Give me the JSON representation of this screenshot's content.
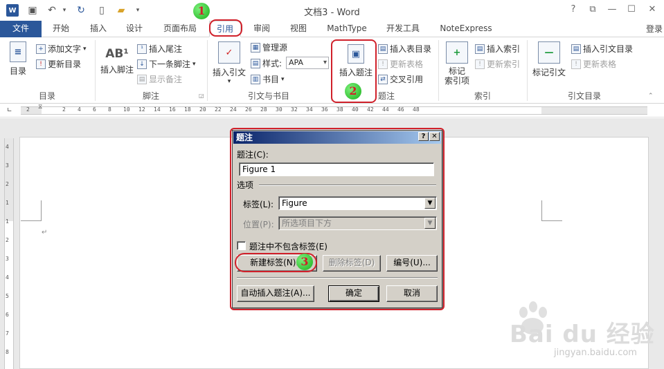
{
  "window": {
    "title": "文档3 - Word",
    "controls": [
      "?",
      "⧉",
      "—",
      "☐",
      "✕"
    ]
  },
  "quick_access": {
    "icons": [
      "word-logo",
      "save-icon",
      "undo-icon",
      "redo-icon",
      "new-doc-icon",
      "open-folder-icon",
      "customize-icon"
    ]
  },
  "tabs": [
    {
      "label": "文件"
    },
    {
      "label": "开始"
    },
    {
      "label": "插入"
    },
    {
      "label": "设计"
    },
    {
      "label": "页面布局"
    },
    {
      "label": "引用"
    },
    {
      "label": "审阅"
    },
    {
      "label": "视图"
    },
    {
      "label": "MathType"
    },
    {
      "label": "开发工具"
    },
    {
      "label": "NoteExpress"
    }
  ],
  "login": "登录",
  "ribbon": {
    "groups": [
      {
        "label": "目录"
      },
      {
        "label": "脚注"
      },
      {
        "label": "引文与书目"
      },
      {
        "label": "题注"
      },
      {
        "label": "索引"
      },
      {
        "label": "引文目录"
      }
    ],
    "toc": {
      "big": "目录",
      "add_text": "添加文字",
      "update_toc": "更新目录"
    },
    "footnote": {
      "big": "插入脚注",
      "insert_endnote": "插入尾注",
      "next_footnote": "下一条脚注",
      "show_notes": "显示备注",
      "ab_icon": "AB¹"
    },
    "citation": {
      "big": "插入引文",
      "manage_sources": "管理源",
      "style_label": "样式:",
      "style_value": "APA",
      "bibliography": "书目"
    },
    "caption": {
      "big": "插入题注",
      "insert_table_of_figures": "插入表目录",
      "update_table": "更新表格",
      "cross_reference": "交叉引用"
    },
    "index": {
      "big": "标记\n索引项",
      "insert_index": "插入索引",
      "update_index": "更新索引"
    },
    "toa": {
      "big": "标记引文",
      "insert_toa": "插入引文目录",
      "update_table": "更新表格"
    }
  },
  "ruler": {
    "ticks": [
      "2",
      "2",
      "4",
      "6",
      "8",
      "10",
      "12",
      "14",
      "16",
      "18",
      "20",
      "22",
      "24",
      "26",
      "28",
      "30",
      "32",
      "34",
      "36",
      "38",
      "40",
      "42",
      "44",
      "46",
      "48"
    ],
    "vticks": [
      "4",
      "3",
      "2",
      "1",
      "1",
      "2",
      "3",
      "4",
      "5",
      "6",
      "7",
      "8"
    ]
  },
  "document": {
    "paragraph_mark": "↵"
  },
  "dialog": {
    "title": "题注",
    "help_btn": "?",
    "close_btn": "✕",
    "caption_label": "题注(C):",
    "caption_value": "Figure 1",
    "options_label": "选项",
    "label_label": "标签(L):",
    "label_value": "Figure",
    "position_label": "位置(P):",
    "position_value": "所选项目下方",
    "exclude_label_text": "题注中不包含标签(E)",
    "new_label_btn": "新建标签(N)...",
    "delete_label_btn": "删除标签(D)",
    "numbering_btn": "编号(U)...",
    "autocaption_btn": "自动插入题注(A)...",
    "ok_btn": "确定",
    "cancel_btn": "取消"
  },
  "annotations": {
    "step1": "1",
    "step2": "2",
    "step3": "3"
  },
  "watermark": {
    "text": "Bai du 经验",
    "url": "jingyan.baidu.com"
  }
}
